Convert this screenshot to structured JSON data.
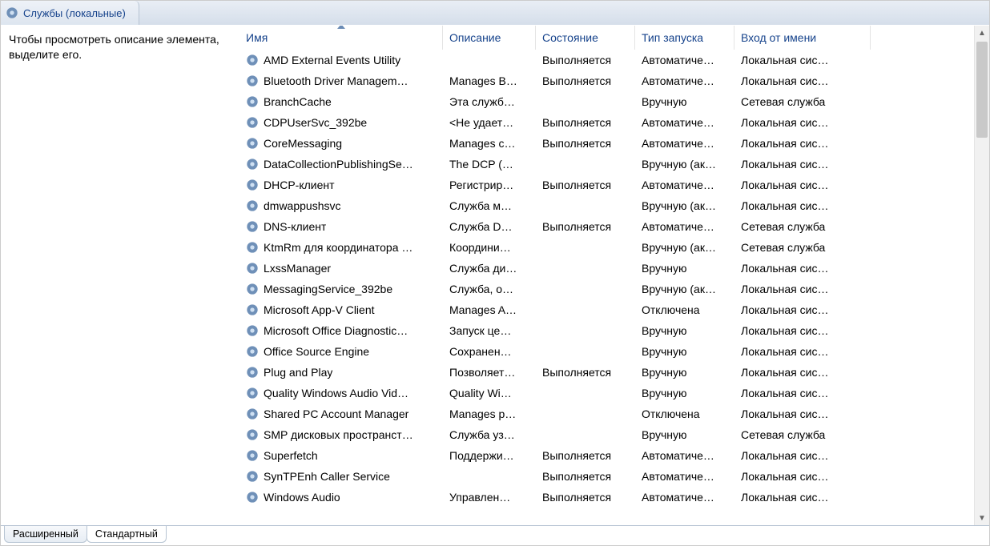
{
  "header": {
    "title": "Службы (локальные)"
  },
  "description_pane": {
    "text": "Чтобы просмотреть описание элемента, выделите его."
  },
  "columns": {
    "name": "Имя",
    "description": "Описание",
    "state": "Состояние",
    "startup": "Тип запуска",
    "logon": "Вход от имени"
  },
  "tabs": {
    "extended": "Расширенный",
    "standard": "Стандартный"
  },
  "services": [
    {
      "name": "AMD External Events Utility",
      "description": "",
      "state": "Выполняется",
      "startup": "Автоматиче…",
      "logon": "Локальная сис…"
    },
    {
      "name": "Bluetooth Driver Managem…",
      "description": "Manages B…",
      "state": "Выполняется",
      "startup": "Автоматиче…",
      "logon": "Локальная сис…"
    },
    {
      "name": "BranchCache",
      "description": "Эта служб…",
      "state": "",
      "startup": "Вручную",
      "logon": "Сетевая служба"
    },
    {
      "name": "CDPUserSvc_392be",
      "description": "<Не удает…",
      "state": "Выполняется",
      "startup": "Автоматиче…",
      "logon": "Локальная сис…"
    },
    {
      "name": "CoreMessaging",
      "description": "Manages c…",
      "state": "Выполняется",
      "startup": "Автоматиче…",
      "logon": "Локальная сис…"
    },
    {
      "name": "DataCollectionPublishingSe…",
      "description": "The DCP (…",
      "state": "",
      "startup": "Вручную (ак…",
      "logon": "Локальная сис…"
    },
    {
      "name": "DHCP-клиент",
      "description": "Регистрир…",
      "state": "Выполняется",
      "startup": "Автоматиче…",
      "logon": "Локальная сис…"
    },
    {
      "name": "dmwappushsvc",
      "description": "Служба м…",
      "state": "",
      "startup": "Вручную (ак…",
      "logon": "Локальная сис…"
    },
    {
      "name": "DNS-клиент",
      "description": "Служба D…",
      "state": "Выполняется",
      "startup": "Автоматиче…",
      "logon": "Сетевая служба"
    },
    {
      "name": "KtmRm для координатора …",
      "description": "Координи…",
      "state": "",
      "startup": "Вручную (ак…",
      "logon": "Сетевая служба"
    },
    {
      "name": "LxssManager",
      "description": "Служба ди…",
      "state": "",
      "startup": "Вручную",
      "logon": "Локальная сис…"
    },
    {
      "name": "MessagingService_392be",
      "description": "Служба, о…",
      "state": "",
      "startup": "Вручную (ак…",
      "logon": "Локальная сис…"
    },
    {
      "name": "Microsoft App-V Client",
      "description": "Manages A…",
      "state": "",
      "startup": "Отключена",
      "logon": "Локальная сис…"
    },
    {
      "name": "Microsoft Office Diagnostic…",
      "description": "Запуск це…",
      "state": "",
      "startup": "Вручную",
      "logon": "Локальная сис…"
    },
    {
      "name": "Office Source Engine",
      "description": "Сохранен…",
      "state": "",
      "startup": "Вручную",
      "logon": "Локальная сис…"
    },
    {
      "name": "Plug and Play",
      "description": "Позволяет…",
      "state": "Выполняется",
      "startup": "Вручную",
      "logon": "Локальная сис…"
    },
    {
      "name": "Quality Windows Audio Vid…",
      "description": "Quality Wi…",
      "state": "",
      "startup": "Вручную",
      "logon": "Локальная сис…"
    },
    {
      "name": "Shared PC Account Manager",
      "description": "Manages p…",
      "state": "",
      "startup": "Отключена",
      "logon": "Локальная сис…"
    },
    {
      "name": "SMP дисковых пространст…",
      "description": "Служба уз…",
      "state": "",
      "startup": "Вручную",
      "logon": "Сетевая служба"
    },
    {
      "name": "Superfetch",
      "description": "Поддержи…",
      "state": "Выполняется",
      "startup": "Автоматиче…",
      "logon": "Локальная сис…"
    },
    {
      "name": "SynTPEnh Caller Service",
      "description": "",
      "state": "Выполняется",
      "startup": "Автоматиче…",
      "logon": "Локальная сис…"
    },
    {
      "name": "Windows Audio",
      "description": "Управлен…",
      "state": "Выполняется",
      "startup": "Автоматиче…",
      "logon": "Локальная сис…"
    }
  ]
}
